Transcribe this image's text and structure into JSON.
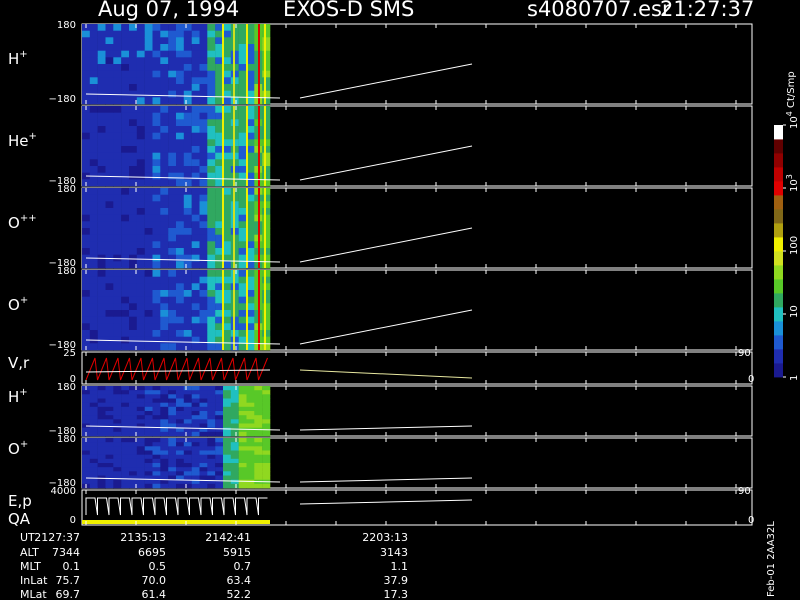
{
  "header": {
    "date": "Aug 07, 1994",
    "instrument": "EXOS-D SMS",
    "file": "s4080707.esr",
    "time": "21:27:37"
  },
  "colorbar": {
    "unit": "Ct/Smp",
    "tick_labels": [
      "1",
      "10",
      "100",
      "10",
      "10"
    ],
    "tick_exponents": [
      "",
      "",
      "",
      "3",
      "4"
    ],
    "tick_values": [
      1,
      10,
      100,
      1000,
      10000
    ],
    "colors": [
      "#1a1a90",
      "#1f2db0",
      "#1f5ad0",
      "#1a90d8",
      "#20c0c0",
      "#30a860",
      "#58c828",
      "#90d820",
      "#d0e020",
      "#f0f000",
      "#b0a010",
      "#806818",
      "#a06010",
      "#e00000",
      "#c00000",
      "#900000",
      "#600000",
      "#ffffff"
    ]
  },
  "panels": [
    {
      "label": "H",
      "sup": "+",
      "y_top": "180",
      "y_bottom": "−180",
      "right_top": "",
      "right_bottom": "",
      "type": "spectrogram",
      "line_start": [
        -170,
        -175
      ],
      "line_end": [
        -160,
        -55
      ]
    },
    {
      "label": "He",
      "sup": "+",
      "y_top": "",
      "y_bottom": "−180",
      "right_top": "",
      "right_bottom": "",
      "type": "spectrogram",
      "line_start": [
        -170,
        -175
      ],
      "line_end": [
        -160,
        -55
      ]
    },
    {
      "label": "O",
      "sup": "++",
      "y_top": "180",
      "y_bottom": "−180",
      "right_top": "",
      "right_bottom": "",
      "type": "spectrogram",
      "line_start": [
        -170,
        -175
      ],
      "line_end": [
        -160,
        -55
      ]
    },
    {
      "label": "O",
      "sup": "+",
      "y_top": "180",
      "y_bottom": "−180",
      "right_top": "",
      "right_bottom": "",
      "type": "spectrogram",
      "line_start": [
        -170,
        -175
      ],
      "line_end": [
        -160,
        -55
      ]
    },
    {
      "label": "V,r",
      "sup": "",
      "y_top": "25",
      "y_bottom": "0",
      "right_top": "90",
      "right_bottom": "0",
      "type": "line"
    },
    {
      "label": "H",
      "sup": "+",
      "y_top": "180",
      "y_bottom": "−180",
      "right_top": "",
      "right_bottom": "",
      "type": "spectrogram",
      "line_start": [
        -170,
        -175
      ],
      "line_end": [
        -160,
        -55
      ]
    },
    {
      "label": "O",
      "sup": "+",
      "y_top": "180",
      "y_bottom": "−180",
      "right_top": "",
      "right_bottom": "",
      "type": "spectrogram",
      "line_start": [
        -170,
        -175
      ],
      "line_end": [
        -160,
        -55
      ]
    },
    {
      "label": "E,p",
      "sup": "",
      "label2": "QA",
      "y_top": "4000",
      "y_bottom": "0",
      "right_top": "90",
      "right_bottom": "0",
      "type": "line"
    }
  ],
  "time_axis": {
    "labels": [
      "UT",
      "ALT",
      "MLT",
      "InLat",
      "MLat"
    ],
    "times": [
      "2127:37",
      "2135:13",
      "2142:41",
      "2203:13"
    ],
    "alt": [
      "7344",
      "6695",
      "5915",
      "3143"
    ],
    "mlt": [
      "0.1",
      "0.5",
      "0.7",
      "1.1"
    ],
    "inlat": [
      "75.7",
      "70.0",
      "63.4",
      "37.9"
    ],
    "mlat": [
      "69.7",
      "61.4",
      "52.2",
      "17.3"
    ]
  },
  "footer": {
    "rotated_text": "Feb-01 2AA32L"
  },
  "chart_data": {
    "type": "heatmap",
    "title": "Aug 07, 1994   EXOS-D SMS",
    "xlabel": "UT",
    "ylabel": "",
    "time_ticks_ut": [
      "2127:37",
      "2135:13",
      "2142:41",
      "2203:13"
    ],
    "series": [
      {
        "name": "H+",
        "ylim": [
          -180,
          180
        ]
      },
      {
        "name": "He+",
        "ylim": [
          -180,
          180
        ]
      },
      {
        "name": "O++",
        "ylim": [
          -180,
          180
        ]
      },
      {
        "name": "O+",
        "ylim": [
          -180,
          180
        ]
      },
      {
        "name": "V,r",
        "ylim": [
          0,
          25
        ],
        "right_ylim": [
          0,
          90
        ]
      },
      {
        "name": "H+",
        "ylim": [
          -180,
          180
        ]
      },
      {
        "name": "O+",
        "ylim": [
          -180,
          180
        ]
      },
      {
        "name": "E,p QA",
        "ylim": [
          0,
          4000
        ],
        "right_ylim": [
          0,
          90
        ]
      }
    ],
    "colorbar_unit": "Ct/Smp",
    "colorbar_range": [
      1,
      10000
    ],
    "colorbar_scale": "log"
  }
}
